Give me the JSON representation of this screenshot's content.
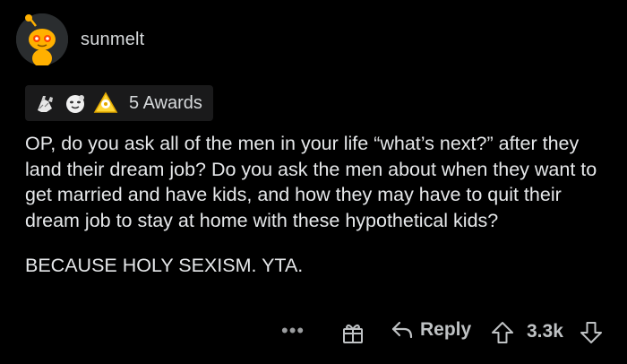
{
  "comment": {
    "author": "sunmelt",
    "avatar_icon": "snoo-avatar-icon",
    "awards": {
      "icons": [
        "hands-award-icon",
        "wholesome-seal-award-icon",
        "helpful-award-icon"
      ],
      "label": "5 Awards"
    },
    "paragraphs": [
      "OP, do you ask all of the men in your life “what’s next?” after they land their dream job? Do you ask the men about when they want to get married and have kids, and how they may have to quit their dream job to stay at home with these hypothetical kids?",
      "BECAUSE HOLY SEXISM. YTA."
    ]
  },
  "actions": {
    "more_label": "•••",
    "give_award_icon": "gift-icon",
    "reply_label": "Reply",
    "reply_icon": "reply-arrow-icon",
    "upvote_icon": "upvote-arrow-icon",
    "score": "3.3k",
    "downvote_icon": "downvote-arrow-icon"
  },
  "colors": {
    "background": "#000000",
    "text": "#d7dadc",
    "muted": "#9a9c9e",
    "avatar_orange": "#ff8717"
  }
}
